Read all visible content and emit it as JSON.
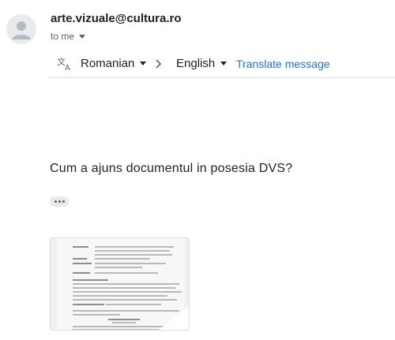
{
  "sender": {
    "email": "arte.vizuale@cultura.ro",
    "to_label": "to me"
  },
  "translate_bar": {
    "source_language": "Romanian",
    "target_language": "English",
    "translate_link": "Translate message"
  },
  "message": {
    "text": "Cum a ajuns documentul in posesia DVS?"
  },
  "icons": {
    "avatar": "person-icon",
    "translate": "translate-icon",
    "arrow": "chevron-right-icon",
    "more": "more-horiz-icon"
  },
  "colors": {
    "link": "#1a73e8",
    "secondary_text": "#5f6368",
    "avatar_bg": "#e8eaed"
  }
}
